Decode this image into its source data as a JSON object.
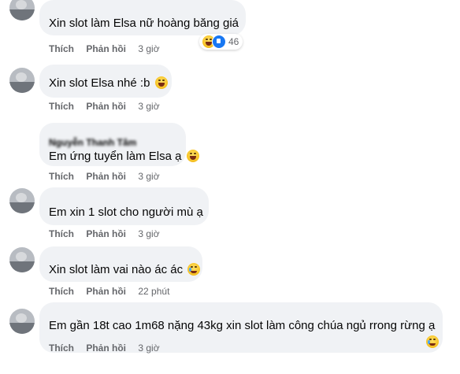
{
  "comments": [
    {
      "author": "",
      "text": "Xin slot làm Elsa nữ hoàng băng giá",
      "emoji": "",
      "reaction_count": "46",
      "like": "Thích",
      "reply": "Phản hồi",
      "time": "3 giờ"
    },
    {
      "author": "",
      "text": "Xin slot Elsa nhé :b",
      "emoji": "laughing-emoji",
      "like": "Thích",
      "reply": "Phản hồi",
      "time": "3 giờ"
    },
    {
      "author": "Nguyễn Thanh Tâm",
      "text": "Em ứng tuyển làm Elsa ạ",
      "emoji": "laughing-emoji",
      "like": "Thích",
      "reply": "Phản hồi",
      "time": "3 giờ"
    },
    {
      "author": "",
      "text": "Em xin 1 slot cho người mù ạ",
      "emoji": "",
      "like": "Thích",
      "reply": "Phản hồi",
      "time": "3 giờ"
    },
    {
      "author": "",
      "text": "Xin slot làm vai nào ác ác",
      "emoji": "crying-emoji",
      "like": "Thích",
      "reply": "Phản hồi",
      "time": "22 phút"
    },
    {
      "author": "",
      "text": "Em gần 18t cao 1m68 nặng 43kg xin slot làm công chúa ngủ rrong rừng ạ",
      "emoji": "crying-emoji",
      "like": "Thích",
      "reply": "Phản hồi",
      "time": "3 giờ"
    }
  ],
  "colors": {
    "bubble": "#f0f2f5",
    "meta": "#65676b",
    "like_blue": "#1877f2"
  }
}
